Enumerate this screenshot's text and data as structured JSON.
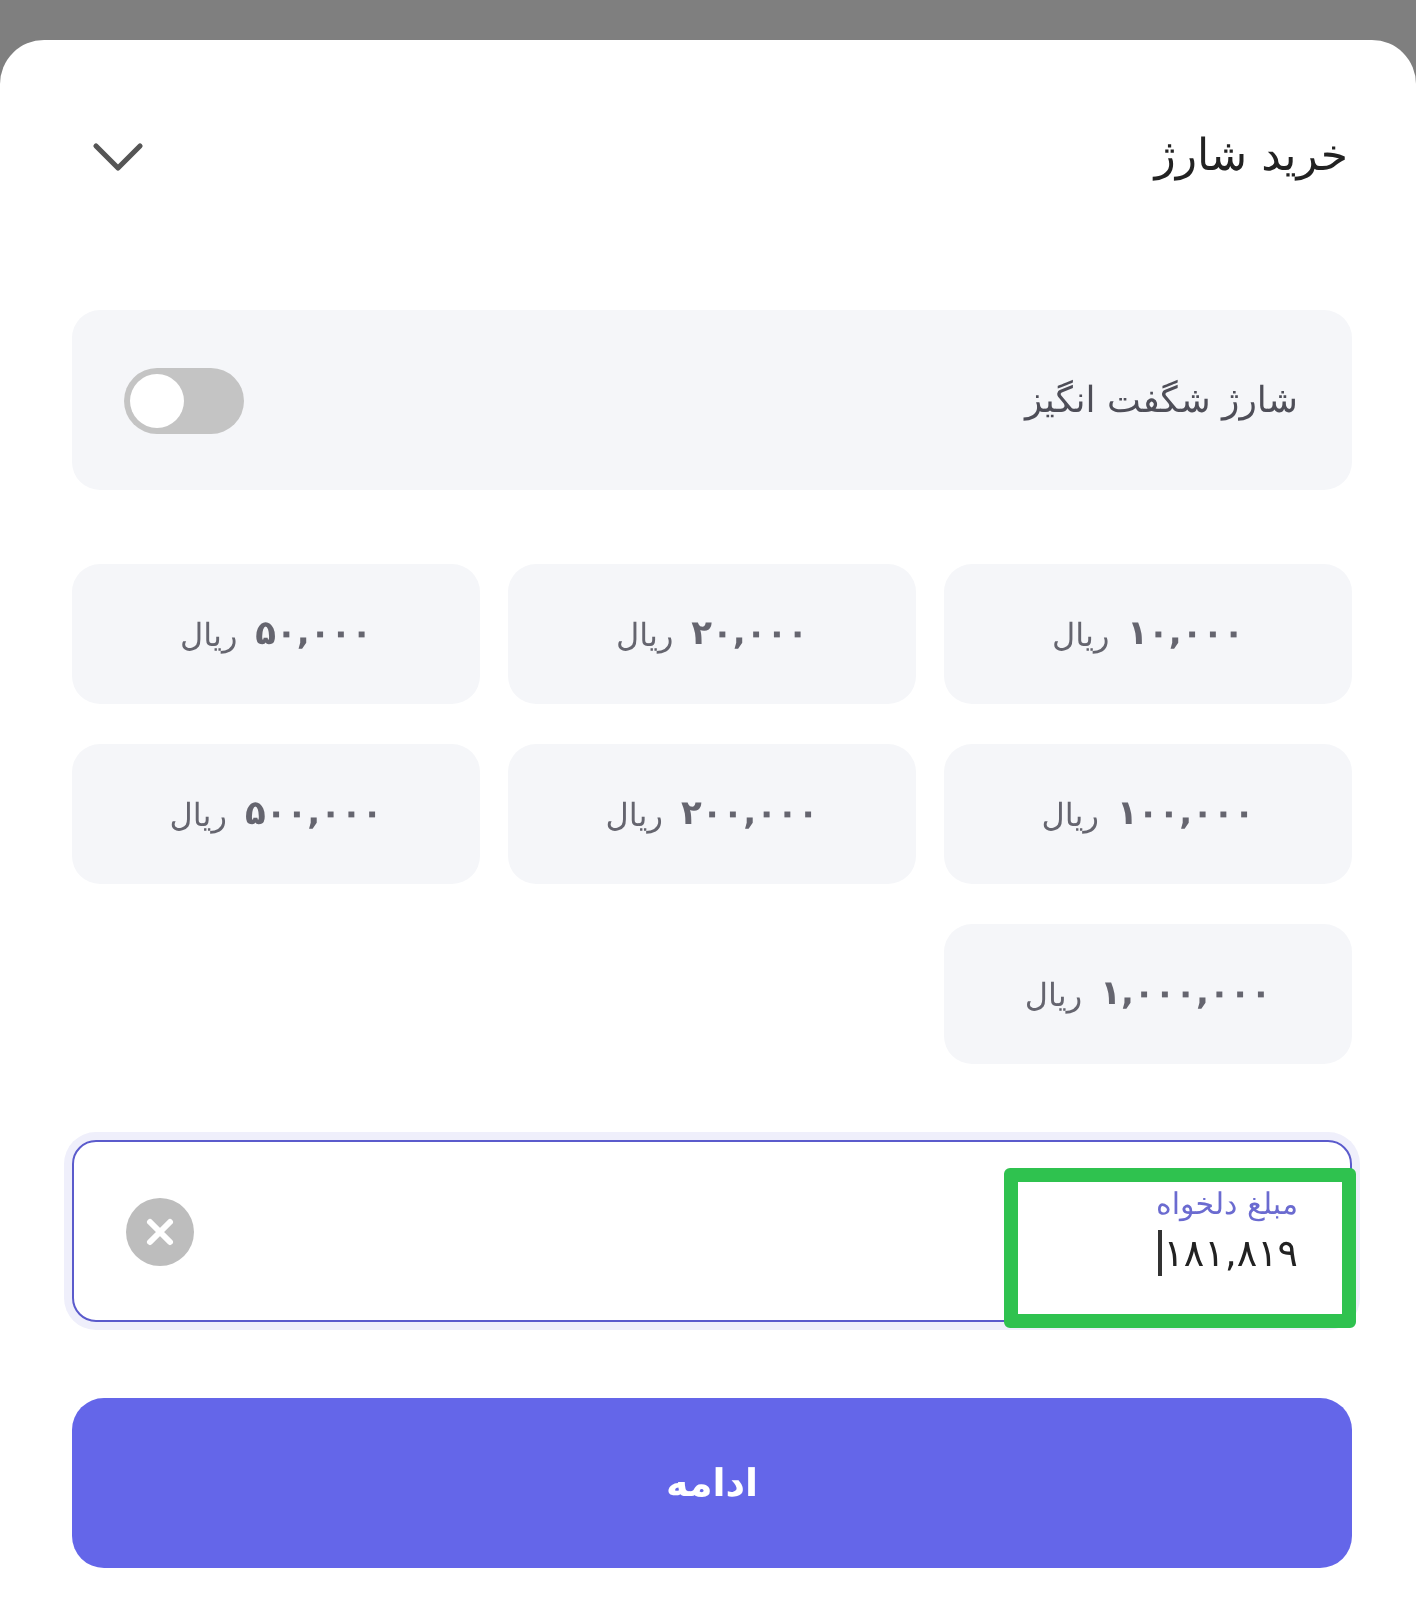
{
  "header": {
    "title": "خرید شارژ"
  },
  "amazing_charge": {
    "label": "شارژ شگفت انگیز",
    "on": false
  },
  "amounts": [
    {
      "amount": "۱۰,۰۰۰",
      "currency": "ریال",
      "selected": false
    },
    {
      "amount": "۲۰,۰۰۰",
      "currency": "ریال",
      "selected": false
    },
    {
      "amount": "۵۰,۰۰۰",
      "currency": "ریال",
      "selected": false
    },
    {
      "amount": "۱۰۰,۰۰۰",
      "currency": "ریال",
      "selected": false
    },
    {
      "amount": "۲۰۰,۰۰۰",
      "currency": "ریال",
      "selected": false
    },
    {
      "amount": "۵۰۰,۰۰۰",
      "currency": "ریال",
      "selected": false
    },
    {
      "amount": "۱,۰۰۰,۰۰۰",
      "currency": "ریال",
      "selected": false
    }
  ],
  "custom_amount": {
    "label": "مبلغ دلخواه",
    "value": "۱۸۱,۸۱۹",
    "highlighted": true
  },
  "continue_button": {
    "label": "ادامه"
  }
}
